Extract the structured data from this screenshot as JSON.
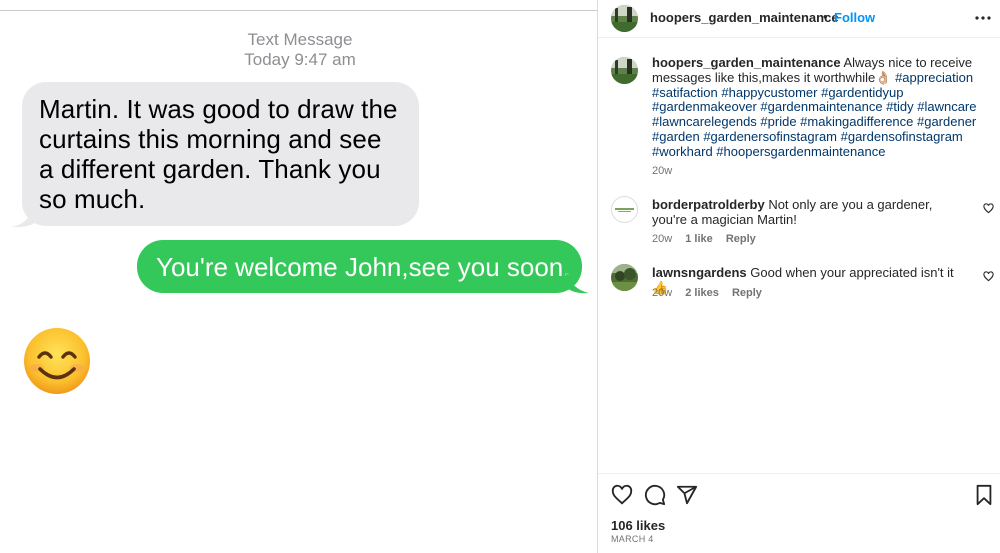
{
  "message_screenshot": {
    "meta_line1": "Text Message",
    "meta_line2": "Today 9:47 am",
    "incoming_text": "Martin. It was good to draw the curtains this morning and see a different garden. Thank you so much.",
    "outgoing_text": "You're welcome John,see you soon.",
    "emoji_icon": "smiling-face-emoji",
    "colors": {
      "incoming_bubble": "#e9e9eb",
      "outgoing_bubble": "#34c759",
      "meta_text": "#8e8e93"
    }
  },
  "post_header": {
    "username": "hoopers_garden_maintenance",
    "separator": "•",
    "follow_label": "Follow",
    "more_icon": "more-horizontal-icon"
  },
  "caption": {
    "username": "hoopers_garden_maintenance",
    "text": "Always nice to receive messages like this,makes it worthwhile👌🏼",
    "hashtags": "#appreciation #satifaction #happycustomer #gardentidyup #gardenmakeover #gardenmaintenance #tidy #lawncare #lawncarelegends #pride #makingadifference #gardener #garden #gardenersofinstagram #gardensofinstagram #workhard #hoopersgardenmaintenance",
    "time": "20w"
  },
  "comments": [
    {
      "username": "borderpatrolderby",
      "text": "Not only are you a gardener, you're a magician Martin!",
      "time": "20w",
      "likes": "1 like",
      "reply": "Reply"
    },
    {
      "username": "lawnsngardens",
      "text": "Good when your appreciated isn't it 👍",
      "time": "20w",
      "likes": "2 likes",
      "reply": "Reply"
    }
  ],
  "footer": {
    "likes": "106 likes",
    "date": "MARCH 4",
    "icons": [
      "heart-icon",
      "comment-icon",
      "share-icon",
      "bookmark-icon"
    ]
  },
  "colors": {
    "link_blue": "#0095f6",
    "hashtag": "#00376b",
    "secondary_text": "#737373"
  }
}
